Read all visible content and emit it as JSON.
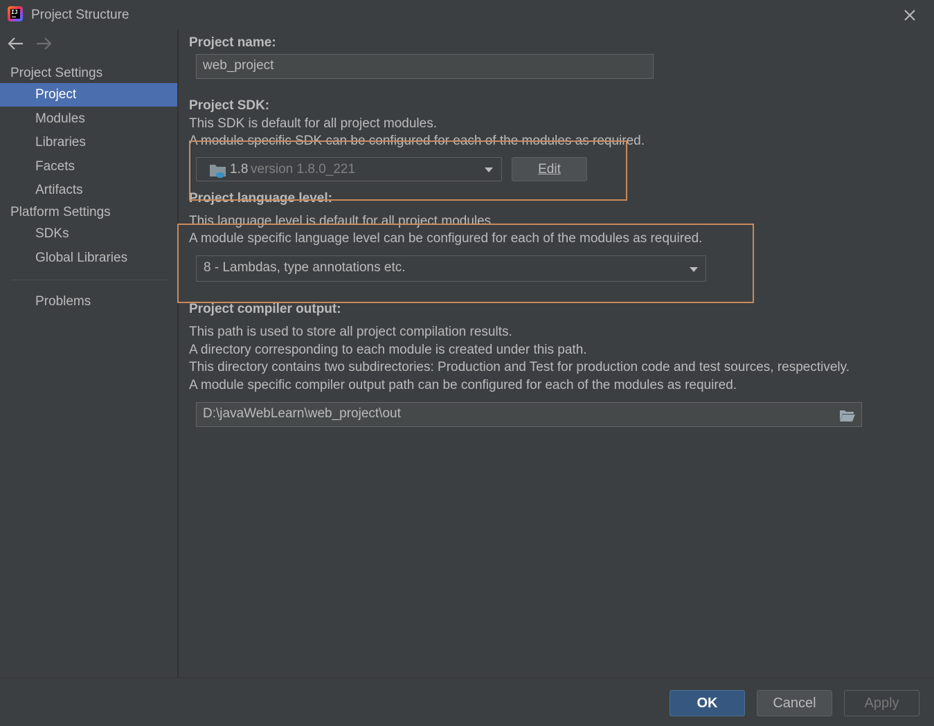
{
  "window": {
    "title": "Project Structure"
  },
  "sidebar": {
    "sections": [
      {
        "label": "Project Settings",
        "items": [
          "Project",
          "Modules",
          "Libraries",
          "Facets",
          "Artifacts"
        ]
      },
      {
        "label": "Platform Settings",
        "items": [
          "SDKs",
          "Global Libraries"
        ]
      }
    ],
    "selected": "Project",
    "problems": "Problems"
  },
  "project_name": {
    "label": "Project name:",
    "value": "web_project"
  },
  "sdk": {
    "label": "Project SDK:",
    "desc1": "This SDK is default for all project modules.",
    "desc2": "A module specific SDK can be configured for each of the modules as required.",
    "selected_name": "1.8",
    "selected_version": "version 1.8.0_221",
    "edit_label": "Edit"
  },
  "language_level": {
    "label": "Project language level:",
    "desc1": "This language level is default for all project modules.",
    "desc2": "A module specific language level can be configured for each of the modules as required.",
    "selected": "8 - Lambdas, type annotations etc."
  },
  "compiler_output": {
    "label": "Project compiler output:",
    "desc1": "This path is used to store all project compilation results.",
    "desc2": "A directory corresponding to each module is created under this path.",
    "desc3": "This directory contains two subdirectories: Production and Test for production code and test sources, respectively.",
    "desc4": "A module specific compiler output path can be configured for each of the modules as required.",
    "path": "D:\\javaWebLearn\\web_project\\out"
  },
  "footer": {
    "ok": "OK",
    "cancel": "Cancel",
    "apply": "Apply"
  },
  "colors": {
    "background": "#3c3f41",
    "selection": "#4b6eaf",
    "annotation": "#c98a5c",
    "primary_button": "#365880"
  }
}
